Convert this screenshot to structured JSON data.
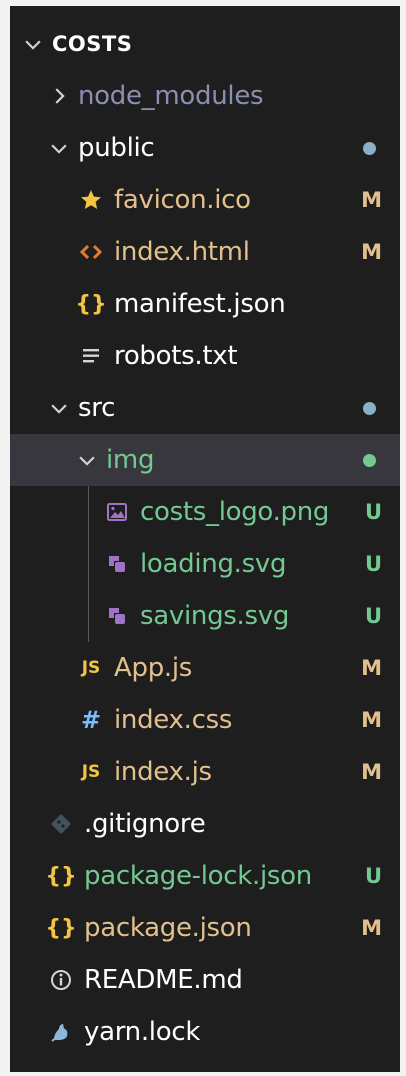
{
  "explorer": {
    "root": {
      "label": "COSTS"
    },
    "items": [
      {
        "label": "node_modules"
      },
      {
        "label": "public"
      },
      {
        "label": "favicon.ico",
        "badge": "M"
      },
      {
        "label": "index.html",
        "badge": "M"
      },
      {
        "label": "manifest.json"
      },
      {
        "label": "robots.txt"
      },
      {
        "label": "src"
      },
      {
        "label": "img"
      },
      {
        "label": "costs_logo.png",
        "badge": "U"
      },
      {
        "label": "loading.svg",
        "badge": "U"
      },
      {
        "label": "savings.svg",
        "badge": "U"
      },
      {
        "label": "App.js",
        "badge": "M"
      },
      {
        "label": "index.css",
        "badge": "M"
      },
      {
        "label": "index.js",
        "badge": "M"
      },
      {
        "label": ".gitignore"
      },
      {
        "label": "package-lock.json",
        "badge": "U"
      },
      {
        "label": "package.json",
        "badge": "M"
      },
      {
        "label": "README.md"
      },
      {
        "label": "yarn.lock"
      }
    ],
    "icon_text": {
      "curly": "{}",
      "js": "JS",
      "hash": "#"
    }
  },
  "colors": {
    "background": "#1e1e1e",
    "selected_row": "#37373d",
    "ignored_text": "#8a8fb3",
    "modified": "#e2c08d",
    "untracked": "#73c991",
    "folder_dot_modified": "#8ab0c6",
    "folder_dot_untracked": "#73c991"
  }
}
